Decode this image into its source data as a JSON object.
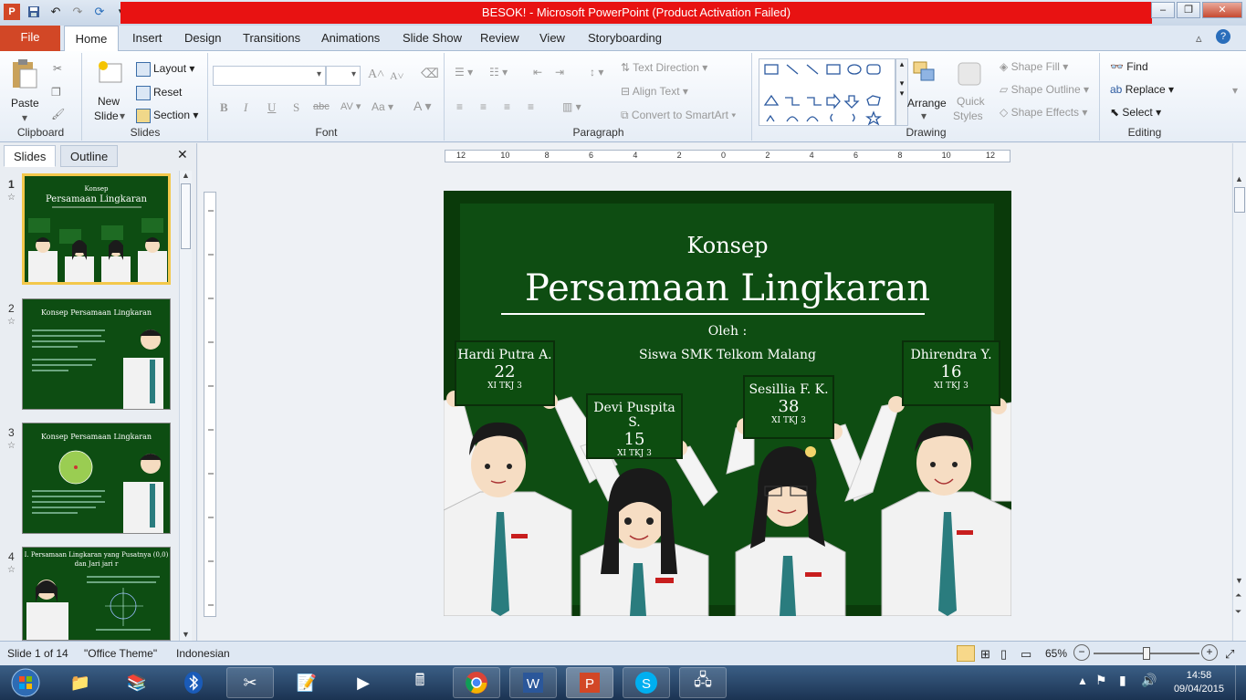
{
  "window": {
    "title": "BESOK!  -  Microsoft PowerPoint (Product Activation Failed)",
    "title_color": "#e81212"
  },
  "tabs": {
    "file": "File",
    "items": [
      "Home",
      "Insert",
      "Design",
      "Transitions",
      "Animations",
      "Slide Show",
      "Review",
      "View",
      "Storyboarding"
    ]
  },
  "ribbon": {
    "clipboard": {
      "label": "Clipboard",
      "paste": "Paste"
    },
    "slides": {
      "label": "Slides",
      "new_slide": "New",
      "new_slide2": "Slide",
      "layout": "Layout",
      "reset": "Reset",
      "section": "Section"
    },
    "font": {
      "label": "Font"
    },
    "paragraph": {
      "label": "Paragraph",
      "text_direction": "Text Direction",
      "align_text": "Align Text",
      "convert": "Convert to SmartArt"
    },
    "drawing": {
      "label": "Drawing",
      "arrange": "Arrange",
      "quick_styles": "Quick",
      "quick_styles2": "Styles",
      "shape_fill": "Shape Fill",
      "shape_outline": "Shape Outline",
      "shape_effects": "Shape Effects"
    },
    "editing": {
      "label": "Editing",
      "find": "Find",
      "replace": "Replace",
      "select": "Select"
    }
  },
  "panes": {
    "slides_tab": "Slides",
    "outline_tab": "Outline"
  },
  "thumbs": [
    {
      "num": "1",
      "title": "Persamaan Lingkaran",
      "sub": "Konsep"
    },
    {
      "num": "2",
      "title": "Konsep Persamaan Lingkaran"
    },
    {
      "num": "3",
      "title": "Konsep Persamaan Lingkaran"
    },
    {
      "num": "4",
      "title": "I. Persamaan Lingkaran yang Pusatnya (0,0)",
      "sub": "dan Jari jari r"
    }
  ],
  "ruler": {
    "h_labels": [
      "12",
      "10",
      "8",
      "6",
      "4",
      "2",
      "0",
      "2",
      "4",
      "6",
      "8",
      "10",
      "12"
    ]
  },
  "slide": {
    "konsep": "Konsep",
    "title": "Persamaan Lingkaran",
    "oleh": "Oleh :",
    "school": "Siswa SMK Telkom Malang",
    "students": [
      {
        "name": "Hardi Putra A.",
        "num": "22",
        "cls": "XI TKJ 3"
      },
      {
        "name": "Devi Puspita S.",
        "num": "15",
        "cls": "XI TKJ 3"
      },
      {
        "name": "Sesillia F. K.",
        "num": "38",
        "cls": "XI TKJ 3"
      },
      {
        "name": "Dhirendra Y.",
        "num": "16",
        "cls": "XI TKJ 3"
      }
    ]
  },
  "status": {
    "slide_of": "Slide 1 of 14",
    "theme": "\"Office Theme\"",
    "language": "Indonesian",
    "zoom": "65%",
    "zoom_fraction": 0.5
  },
  "clock": {
    "time": "14:58",
    "date": "09/04/2015"
  }
}
